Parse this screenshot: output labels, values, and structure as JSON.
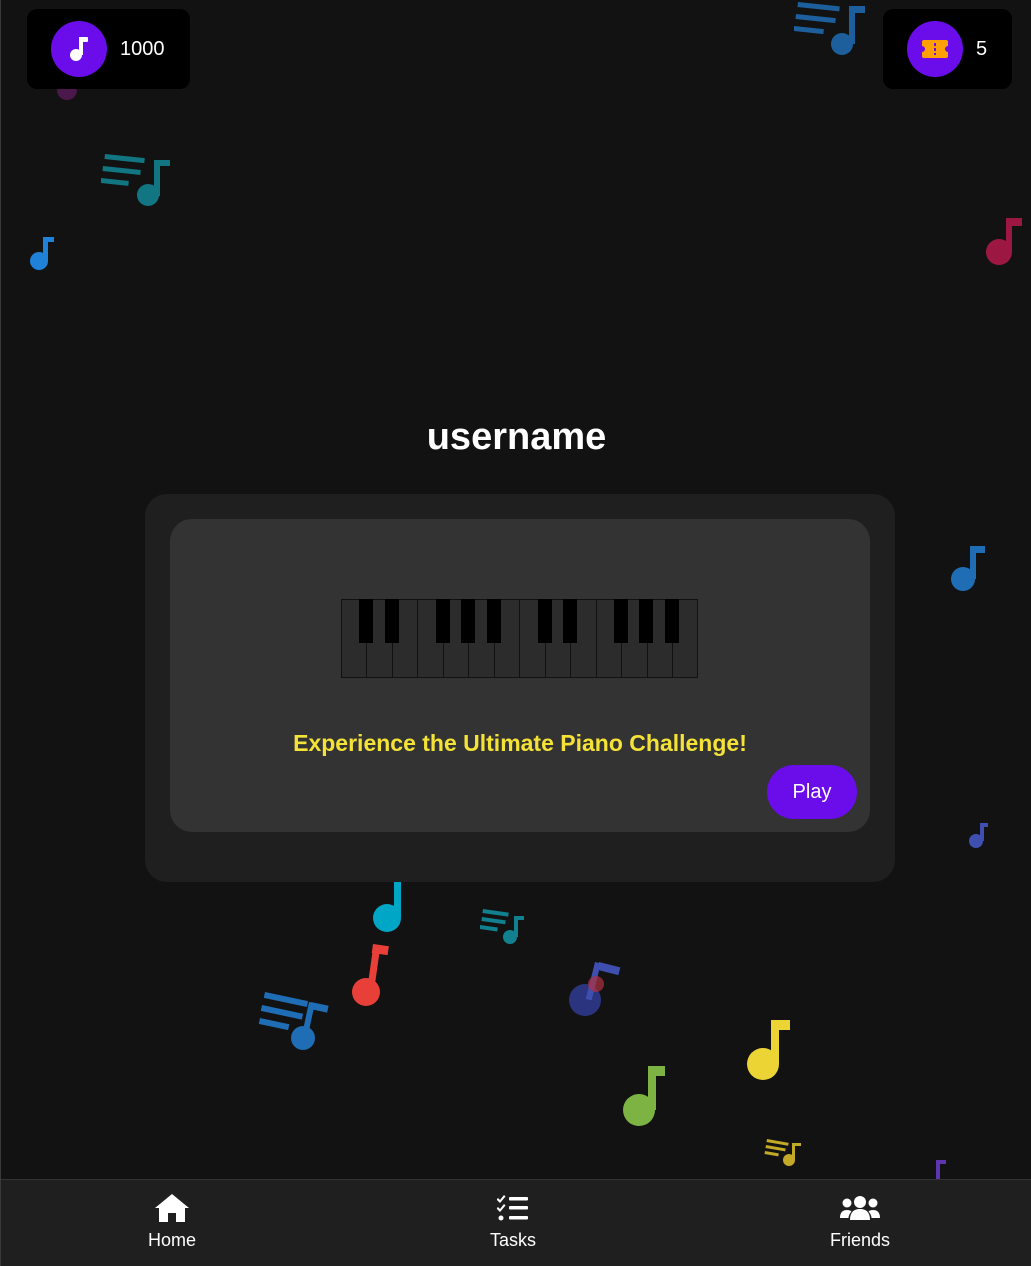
{
  "header": {
    "music_points": "1000",
    "tickets": "5",
    "music_icon": "music-note-icon",
    "ticket_icon": "ticket-icon"
  },
  "main": {
    "username": "username",
    "tagline": "Experience the Ultimate Piano Challenge!",
    "play_label": "Play"
  },
  "nav": {
    "items": [
      {
        "label": "Home",
        "icon": "home-icon"
      },
      {
        "label": "Tasks",
        "icon": "tasks-icon"
      },
      {
        "label": "Friends",
        "icon": "friends-icon"
      }
    ]
  },
  "colors": {
    "accent": "#6a0dea",
    "tagline": "#f4e236",
    "background": "#121212",
    "card": "#333333"
  }
}
